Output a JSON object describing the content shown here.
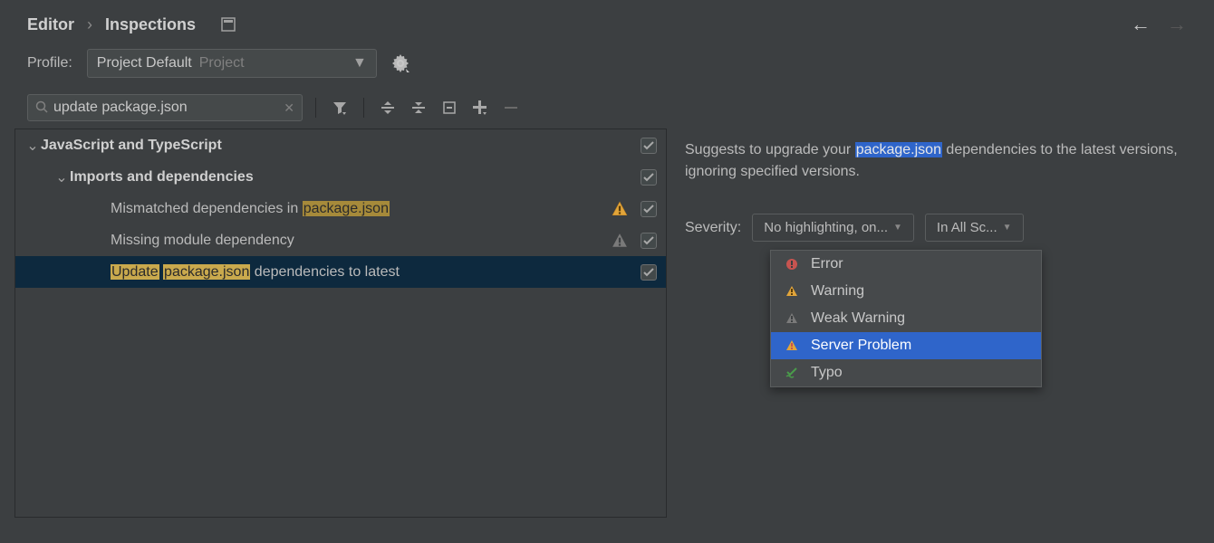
{
  "breadcrumb": {
    "a": "Editor",
    "b": "Inspections"
  },
  "profile": {
    "label": "Profile:",
    "value": "Project Default",
    "scope": "Project"
  },
  "search": {
    "value": "update package.json"
  },
  "tree": {
    "group1": "JavaScript and TypeScript",
    "group2": "Imports and dependencies",
    "item1a": "Mismatched dependencies in ",
    "item1b": "package.json",
    "item2": "Missing module dependency",
    "item3a": "Update",
    "item3b": "package.json",
    "item3c": " dependencies to latest"
  },
  "details": {
    "desc_pre": "Suggests to upgrade your ",
    "desc_hl": "package.json",
    "desc_post": " dependencies to the latest versions, ignoring specified versions."
  },
  "severity": {
    "label": "Severity:",
    "btn1": "No highlighting, on...",
    "btn2": "In All Sc...",
    "options": {
      "error": "Error",
      "warning": "Warning",
      "weak": "Weak Warning",
      "server": "Server Problem",
      "typo": "Typo"
    }
  }
}
